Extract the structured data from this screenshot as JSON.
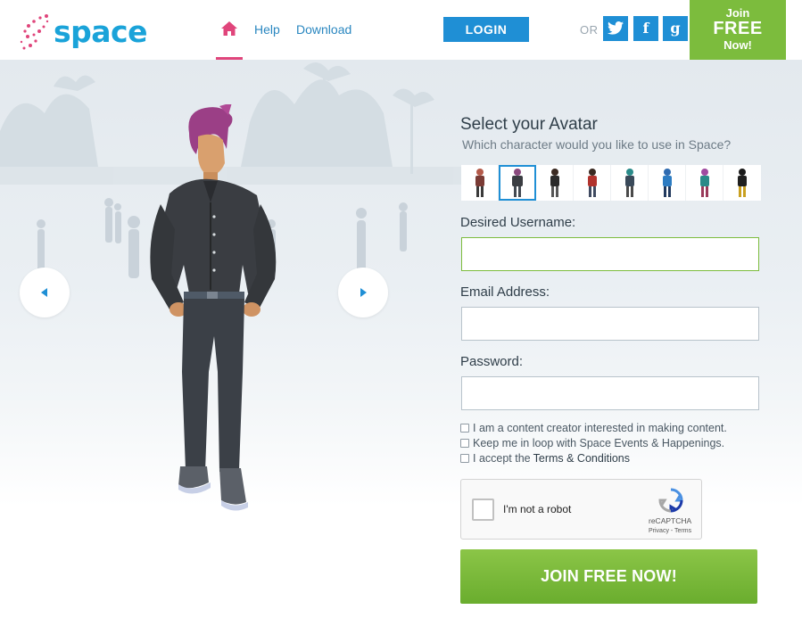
{
  "header": {
    "logo_text": "space",
    "nav": {
      "home_icon": "home-icon",
      "help": "Help",
      "download": "Download"
    },
    "login_label": "LOGIN",
    "or_label": "OR",
    "social": {
      "twitter": "twitter-icon",
      "facebook": "facebook-icon",
      "google": "google-icon",
      "facebook_glyph": "f",
      "google_glyph": "g"
    },
    "join_corner": {
      "line1": "Join",
      "line2": "FREE",
      "line3": "Now!"
    }
  },
  "hero": {
    "prev_icon": "arrow-left-icon",
    "next_icon": "arrow-right-icon"
  },
  "form": {
    "title": "Select your Avatar",
    "subtitle": "Which character would you like to use in Space?",
    "avatars": {
      "count": 8,
      "selected_index": 1
    },
    "username_label": "Desired Username:",
    "username_value": "",
    "email_label": "Email Address:",
    "email_value": "",
    "password_label": "Password:",
    "password_value": "",
    "checkboxes": {
      "content_creator": "I am a content creator interested in making content.",
      "newsletter": "Keep me in loop with Space Events & Happenings.",
      "accept_prefix": "I accept the",
      "terms_link": "Terms & Conditions"
    },
    "captcha": {
      "label": "I'm not a robot",
      "brand": "reCAPTCHA",
      "legal": "Privacy - Terms"
    },
    "submit_label": "JOIN FREE NOW!"
  },
  "colors": {
    "accent_blue": "#1f8fd5",
    "accent_green": "#7cbc3d",
    "accent_pink": "#e0457b"
  }
}
